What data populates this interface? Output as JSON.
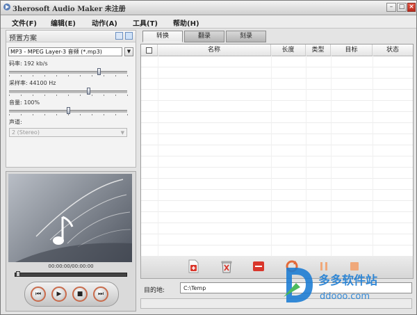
{
  "window": {
    "title": "3herosoft Audio Maker 未注册"
  },
  "menu": [
    "文件(F)",
    "编辑(E)",
    "动作(A)",
    "工具(T)",
    "帮助(H)"
  ],
  "settings": {
    "header": "预置方案",
    "format_value": "MP3 - MPEG Layer-3 音频 (*.mp3)",
    "bitrate_label": "码率: 192 kb/s",
    "bitrate_level": 0.77,
    "samplerate_label": "采样率: 44100 Hz",
    "samplerate_level": 0.68,
    "volume_label": "音量: 100%",
    "volume_level": 0.5,
    "channel_label": "声道:",
    "channel_value": "2 (Stereo)"
  },
  "player": {
    "time": "00:00:00/00:00:00",
    "seek_progress": 0.0
  },
  "tabs": [
    {
      "label": "转换",
      "active": true
    },
    {
      "label": "翻录",
      "active": false
    },
    {
      "label": "刻录",
      "active": false
    }
  ],
  "file_list": {
    "columns": [
      "名称",
      "长度",
      "类型",
      "目标",
      "状态"
    ],
    "rows": []
  },
  "destination": {
    "label": "目的地:",
    "value": "C:\\Temp"
  },
  "watermark": {
    "title": "多多软件站",
    "url": "ddooo.com"
  },
  "colors": {
    "accent_red": "#d9362b",
    "player_ring": "#c96a4a",
    "watermark_blue": "#1a7cd4"
  }
}
